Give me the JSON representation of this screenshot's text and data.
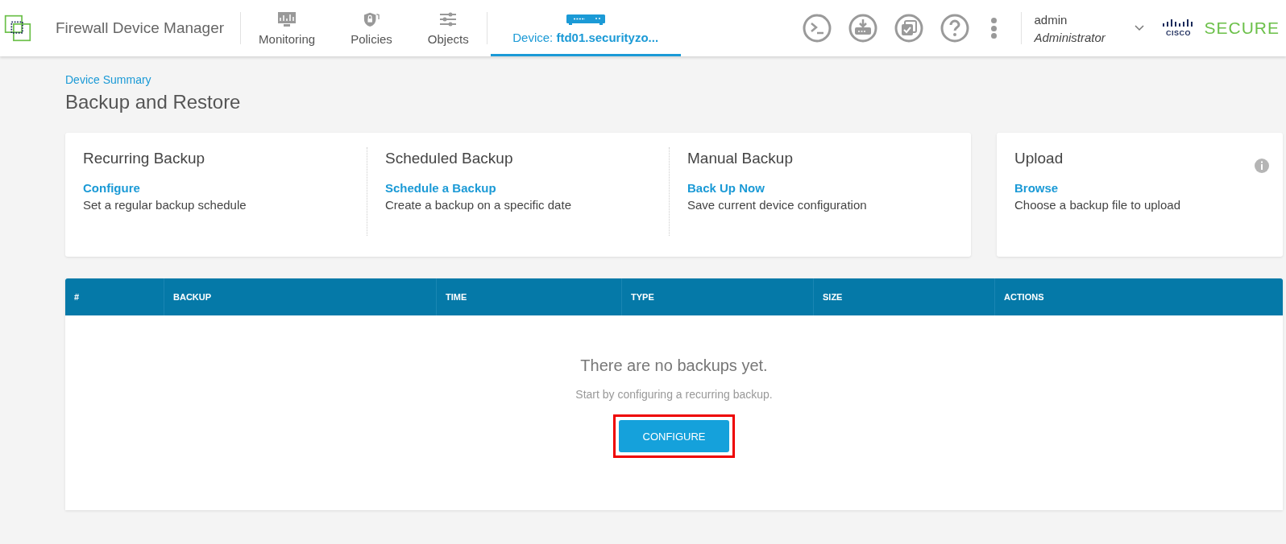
{
  "header": {
    "app_title": "Firewall Device Manager",
    "tabs": [
      {
        "label": "Monitoring",
        "selected": false
      },
      {
        "label": "Policies",
        "selected": false
      },
      {
        "label": "Objects",
        "selected": false
      },
      {
        "label": "Device: **ftd01.securityzo...**",
        "selected": true
      }
    ],
    "user": {
      "name": "admin",
      "role": "Administrator"
    },
    "brand": {
      "wordmark": "CISCO",
      "product": "SECURE"
    }
  },
  "breadcrumb": "Device Summary",
  "page_title": "Backup and Restore",
  "backup_options": [
    {
      "title": "Recurring Backup",
      "link": "Configure",
      "description": "Set a regular backup schedule"
    },
    {
      "title": "Scheduled Backup",
      "link": "Schedule a Backup",
      "description": "Create a backup on a specific date"
    },
    {
      "title": "Manual Backup",
      "link": "Back Up Now",
      "description": "Save current device configuration"
    }
  ],
  "upload": {
    "title": "Upload",
    "link": "Browse",
    "description": "Choose a backup file to upload"
  },
  "table": {
    "columns": [
      "#",
      "BACKUP",
      "TIME",
      "TYPE",
      "SIZE",
      "ACTIONS"
    ],
    "empty_title": "There are no backups yet.",
    "empty_hint": "Start by configuring a recurring backup.",
    "button": "CONFIGURE",
    "highlighted": true
  }
}
